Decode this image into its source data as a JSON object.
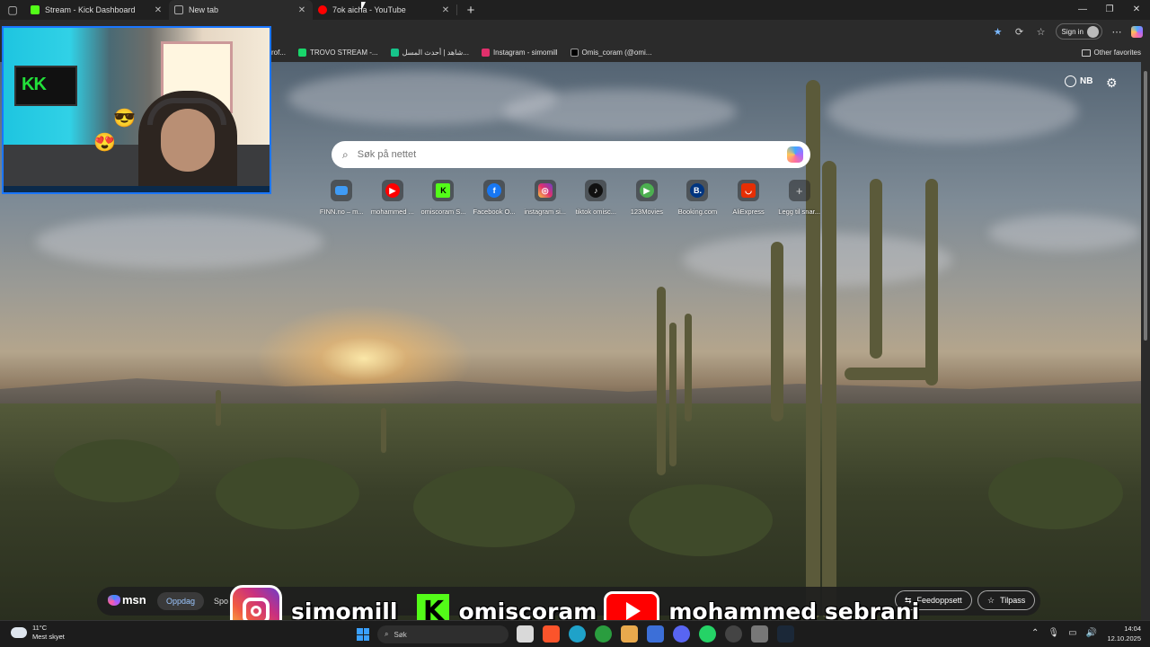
{
  "tabs": [
    {
      "title": "Stream - Kick Dashboard",
      "favicon_color": "#53fc18",
      "favicon": "kick-icon"
    },
    {
      "title": "New tab",
      "favicon_color": "#8a8a8a",
      "favicon": "newtab-icon"
    },
    {
      "title": "7ok aicha - YouTube",
      "favicon_color": "#ff0000",
      "favicon": "youtube-icon"
    }
  ],
  "toolbar": {
    "signin_label": "Sign in",
    "other_favorites": "Other favorites"
  },
  "favorites": [
    {
      "label": "rof...",
      "color": "#7a7a7a"
    },
    {
      "label": "TROVO STREAM -...",
      "color": "#19d66b"
    },
    {
      "label": "شاهد | أحدث المسل...",
      "color": "#16c48a"
    },
    {
      "label": "Instagram - simomill",
      "color": "#e1306c"
    },
    {
      "label": "Omis_coram (@omi...",
      "color": "#000000"
    }
  ],
  "newtab": {
    "language": "NB",
    "search_placeholder": "Søk på nettet",
    "quick_links": [
      {
        "label": "FINN.no – m...",
        "color": "#3f9bf5",
        "glyph": ""
      },
      {
        "label": "mohammed ...",
        "color": "#ff0000",
        "glyph": "▶"
      },
      {
        "label": "omiscoram S...",
        "color": "#53fc18",
        "glyph": "K"
      },
      {
        "label": "Facebook O...",
        "color": "#1877f2",
        "glyph": "f"
      },
      {
        "label": "instagram si...",
        "color": "#d62976",
        "glyph": "◎"
      },
      {
        "label": "tiktok omisc...",
        "color": "#111111",
        "glyph": "♪"
      },
      {
        "label": "123Movies",
        "color": "#4caf50",
        "glyph": "▶"
      },
      {
        "label": "Booking.com",
        "color": "#003580",
        "glyph": "B."
      },
      {
        "label": "AliExpress",
        "color": "#e62e04",
        "glyph": "◡"
      },
      {
        "label": "Legg til snar...",
        "color": "#555555",
        "glyph": "+"
      }
    ]
  },
  "msn": {
    "logo": "msn",
    "tabs": [
      "Oppdag",
      "Spo"
    ],
    "feed_button": "Feedoppsett",
    "customize_button": "Tilpass"
  },
  "social_overlay": {
    "instagram": "simomill",
    "kick": "omiscoram",
    "youtube": "mohammed sebrani"
  },
  "taskbar": {
    "temperature": "11°C",
    "condition": "Mest skyet",
    "search_label": "Søk",
    "time": "14:04",
    "date": "12.10.2025"
  }
}
